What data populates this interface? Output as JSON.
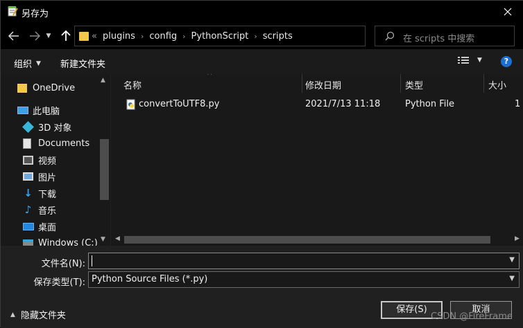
{
  "window": {
    "title": "另存为",
    "close_icon": "close-icon"
  },
  "nav": {
    "back_icon": "arrow-left-icon",
    "forward_icon": "arrow-right-icon",
    "recent_icon": "chevron-down-icon",
    "up_icon": "arrow-up-icon",
    "breadcrumb_overflow": "«",
    "breadcrumbs": [
      "plugins",
      "config",
      "PythonScript",
      "scripts"
    ],
    "search_placeholder": "在 scripts 中搜索"
  },
  "toolbar": {
    "organize_label": "组织",
    "new_folder_label": "新建文件夹"
  },
  "sidebar": {
    "items": [
      {
        "label": "OneDrive",
        "icon": "onedrive-folder-icon"
      },
      {
        "label": "此电脑",
        "icon": "computer-icon"
      },
      {
        "label": "3D 对象",
        "icon": "3d-objects-icon"
      },
      {
        "label": "Documents",
        "icon": "documents-icon"
      },
      {
        "label": "视频",
        "icon": "videos-icon"
      },
      {
        "label": "图片",
        "icon": "pictures-icon"
      },
      {
        "label": "下载",
        "icon": "downloads-icon"
      },
      {
        "label": "音乐",
        "icon": "music-icon"
      },
      {
        "label": "桌面",
        "icon": "desktop-icon"
      },
      {
        "label": "Windows (C:)",
        "icon": "drive-icon"
      }
    ]
  },
  "filelist": {
    "columns": [
      "名称",
      "修改日期",
      "类型",
      "大小"
    ],
    "rows": [
      {
        "name": "convertToUTF8.py",
        "modified": "2021/7/13 11:18",
        "type": "Python File",
        "size": "1"
      }
    ]
  },
  "form": {
    "filename_label": "文件名(N):",
    "filename_value": "",
    "filetype_label": "保存类型(T):",
    "filetype_value": "Python Source Files (*.py)",
    "hide_folders_label": "隐藏文件夹",
    "save_label": "保存(S)",
    "cancel_label": "取消"
  },
  "watermark": "CSDN @FireFrame",
  "colors": {
    "accent": "#1a6fd1",
    "folder": "#f2c94c"
  }
}
